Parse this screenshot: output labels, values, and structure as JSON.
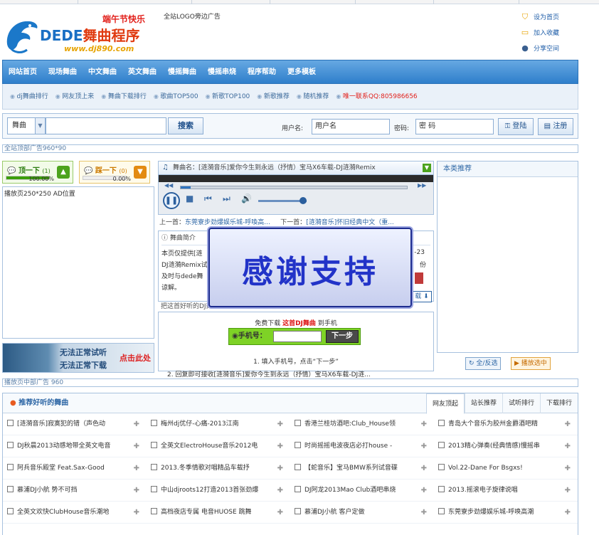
{
  "logo": {
    "festival": "端午节快乐",
    "name_main": "DEDE",
    "name_accent": "舞曲程序",
    "url": "www.dj890.com",
    "side_ad": "全站LOGO旁边广告"
  },
  "quick_links": [
    {
      "icon": "shield-icon",
      "label": "设为首页"
    },
    {
      "icon": "folder-icon",
      "label": "加入收藏"
    },
    {
      "icon": "user-icon",
      "label": "分享空间"
    }
  ],
  "nav": [
    "网站首页",
    "现场舞曲",
    "中文舞曲",
    "英文舞曲",
    "慢摇舞曲",
    "慢摇串烧",
    "程序帮助",
    "更多模板"
  ],
  "subnav": [
    {
      "label": "dj舞曲排行",
      "hot": false
    },
    {
      "label": "网友顶上来",
      "hot": false
    },
    {
      "label": "舞曲下载排行",
      "hot": false
    },
    {
      "label": "歌曲TOP500",
      "hot": false
    },
    {
      "label": "新歌TOP100",
      "hot": false
    },
    {
      "label": "新歌推荐",
      "hot": false
    },
    {
      "label": "随机推荐",
      "hot": false
    },
    {
      "label": "唯一联系QQ:805986656",
      "hot": true
    }
  ],
  "search": {
    "category": "舞曲",
    "button": "搜索",
    "username_label": "用户名:",
    "username_value": "用户名",
    "password_label": "密码:",
    "password_value": "密 码",
    "login": "登陆",
    "register": "注册"
  },
  "ads": {
    "top": "全站顶部广告960*90",
    "player_box": "播放页250*250 AD位置",
    "middle": "播放页中部广告 960"
  },
  "vote": {
    "up_label": "顶一下",
    "up_count": "(1)",
    "up_pct": "100.00%",
    "up_fill": 1.0,
    "down_label": "踩一下",
    "down_count": "(0)",
    "down_pct": "0.00%"
  },
  "banner": {
    "line1": "无法正常试听",
    "line2": "无法正常下载",
    "right": "点击此处"
  },
  "player": {
    "title": "舞曲名：[涟漪音乐]爱你今生到永远（抒情）宝马X6车载-DJ涟漪Remix",
    "prev_label": "上一首：",
    "prev": "东莞寮步劲爆娱乐城-呼喚高...",
    "next_label": "下一首：",
    "next": "[涟漪音乐]怀旧经典中文（重..."
  },
  "intro": {
    "heading": "舞曲简介",
    "lines": [
      "本页仅提供[涟",
      "DJ涟漪Remix试",
      "及时与dede舞",
      "谅解。"
    ],
    "date": "-23",
    "mark": "份",
    "download": "载",
    "share": "把这首好听的DJ舞曲分享到："
  },
  "mobile": {
    "prefix": "免费下载",
    "highlight": "这首DJ舞曲",
    "suffix": "到手机",
    "field_label": "手机号：",
    "button": "下一步",
    "step1": "1. 填入手机号，点击“下一步”",
    "step2": "2. 回复即可接收[涟漪音乐]爱你今生到永远（抒情）宝马X6车载-DJ涟..."
  },
  "popup": {
    "text": "感谢支持"
  },
  "right": {
    "title": "本类推荐",
    "select_all": "全/反选",
    "play_selected": "播放选中"
  },
  "section": {
    "title": "推荐好听的舞曲",
    "tabs": [
      "网友顶起",
      "站长推荐",
      "试听排行",
      "下载排行"
    ],
    "rows": [
      [
        "[涟漪音乐]寂寞犯的错（声色动",
        "梅州dj优仔-心痛-2013江南",
        "香港兰桂坊酒吧:Club_House领",
        "青岛大个音乐为胶州金爵酒吧精"
      ],
      [
        "DJ秋晨2013动感地带全英文电音",
        "全英文ElectroHouse音乐2012电",
        "时尚摇摇电波夜店必打house -",
        "2013精心弹奏(经典情感)慢摇串"
      ],
      [
        "阿兵音乐殿堂 Feat.Sax-Good",
        "2013.冬季情歌对唱精品车载抒",
        "【蛇音乐】宝马BMW系列试音碟",
        "Vol.22-Dane For Bsgxs!"
      ],
      [
        "慕浦DJ小航 势不可挡",
        "中山djroots12打造2013首张劲爆",
        "DJ阿龙2013Mao Club酒吧串烧",
        "2013.摇滚电子旋律说唱"
      ],
      [
        "全英文欢快ClubHouse音乐潮地",
        "高档夜店专属 电音HUOSE 跳舞",
        "慕浦DJ小航 客户定做",
        "东莞寮步劲爆娱乐城-呼唤高潮"
      ]
    ]
  }
}
